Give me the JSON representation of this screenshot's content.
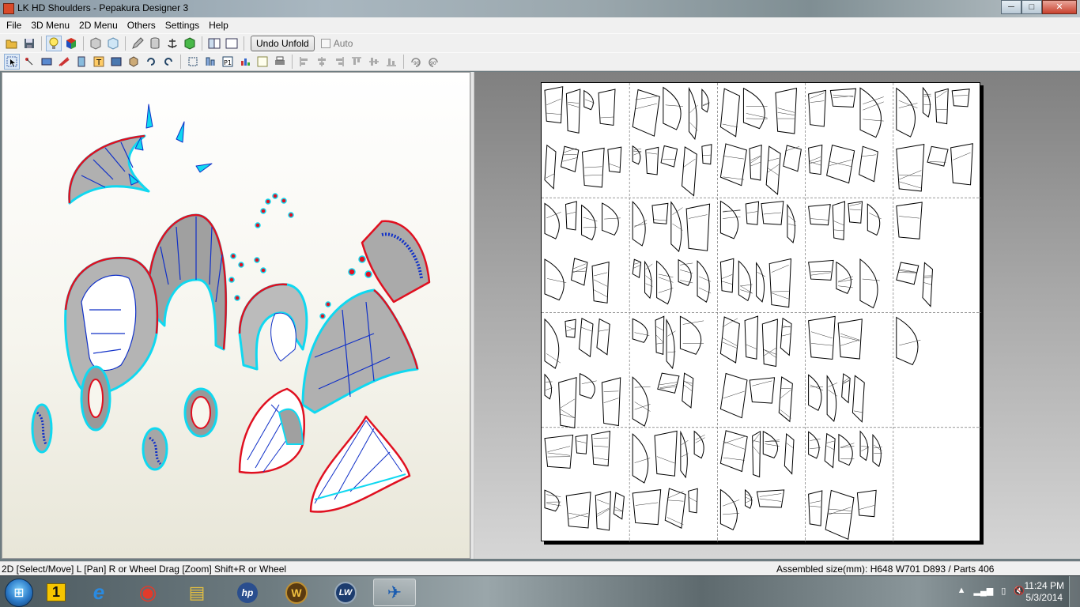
{
  "window": {
    "title": "LK HD Shoulders - Pepakura Designer 3",
    "buttons": {
      "minimize": "─",
      "maximize": "□",
      "close": "✕"
    }
  },
  "menu": [
    "File",
    "3D Menu",
    "2D Menu",
    "Others",
    "Settings",
    "Help"
  ],
  "toolbar1": {
    "icons": [
      "open-icon",
      "save-icon",
      "light-icon",
      "texture-cube-icon",
      "box-icon",
      "box-light-icon",
      "pencil-icon",
      "cylinder-icon",
      "anchor-icon",
      "fold-cube-icon",
      "single-pane-icon",
      "dual-pane-icon"
    ],
    "undo_unfold": "Undo Unfold",
    "auto_label": "Auto"
  },
  "toolbar2": {
    "icons": [
      "select-icon",
      "join-icon",
      "edge-icon",
      "flap-icon",
      "text-icon",
      "text-box-icon",
      "image-icon",
      "rotate-part-icon",
      "rotate-icon",
      "redo-icon",
      "fit-icon",
      "layout-icon",
      "page-icon",
      "scale-icon",
      "sheet-icon",
      "print-icon",
      "align-left-icon",
      "align-center-icon",
      "align-right-icon",
      "align-top-icon",
      "align-middle-icon",
      "align-bottom-icon",
      "rotate-minus-90-icon",
      "rotate-plus-90-icon"
    ]
  },
  "view3d": {
    "edge_colors": {
      "cut": "#e01020",
      "mountain": "#10d8f0",
      "valley": "#1030c8",
      "face": "#a8a8a8"
    }
  },
  "view2d": {
    "page_grid": {
      "columns": 5,
      "rows": 4
    }
  },
  "status": {
    "left": "2D [Select/Move] L [Pan] R or Wheel Drag [Zoom] Shift+R or Wheel",
    "right": "Assembled size(mm): H648 W701 D893 / Parts 406"
  },
  "taskbar": {
    "start": "⊞",
    "apps": [
      {
        "name": "start-orb",
        "label": "⊞"
      },
      {
        "name": "app-1-icon",
        "label": "1"
      },
      {
        "name": "internet-explorer-icon",
        "label": "e"
      },
      {
        "name": "chrome-icon",
        "label": "◉"
      },
      {
        "name": "file-explorer-icon",
        "label": "▤"
      },
      {
        "name": "hp-icon",
        "label": "hp"
      },
      {
        "name": "warcraft-icon",
        "label": "W"
      },
      {
        "name": "lw-icon",
        "label": "LW"
      },
      {
        "name": "pepakura-icon",
        "label": "✈"
      }
    ],
    "tray": [
      "▲",
      "▂▄▆",
      "▯",
      "🔇"
    ],
    "time": "11:24 PM",
    "date": "5/3/2014"
  }
}
